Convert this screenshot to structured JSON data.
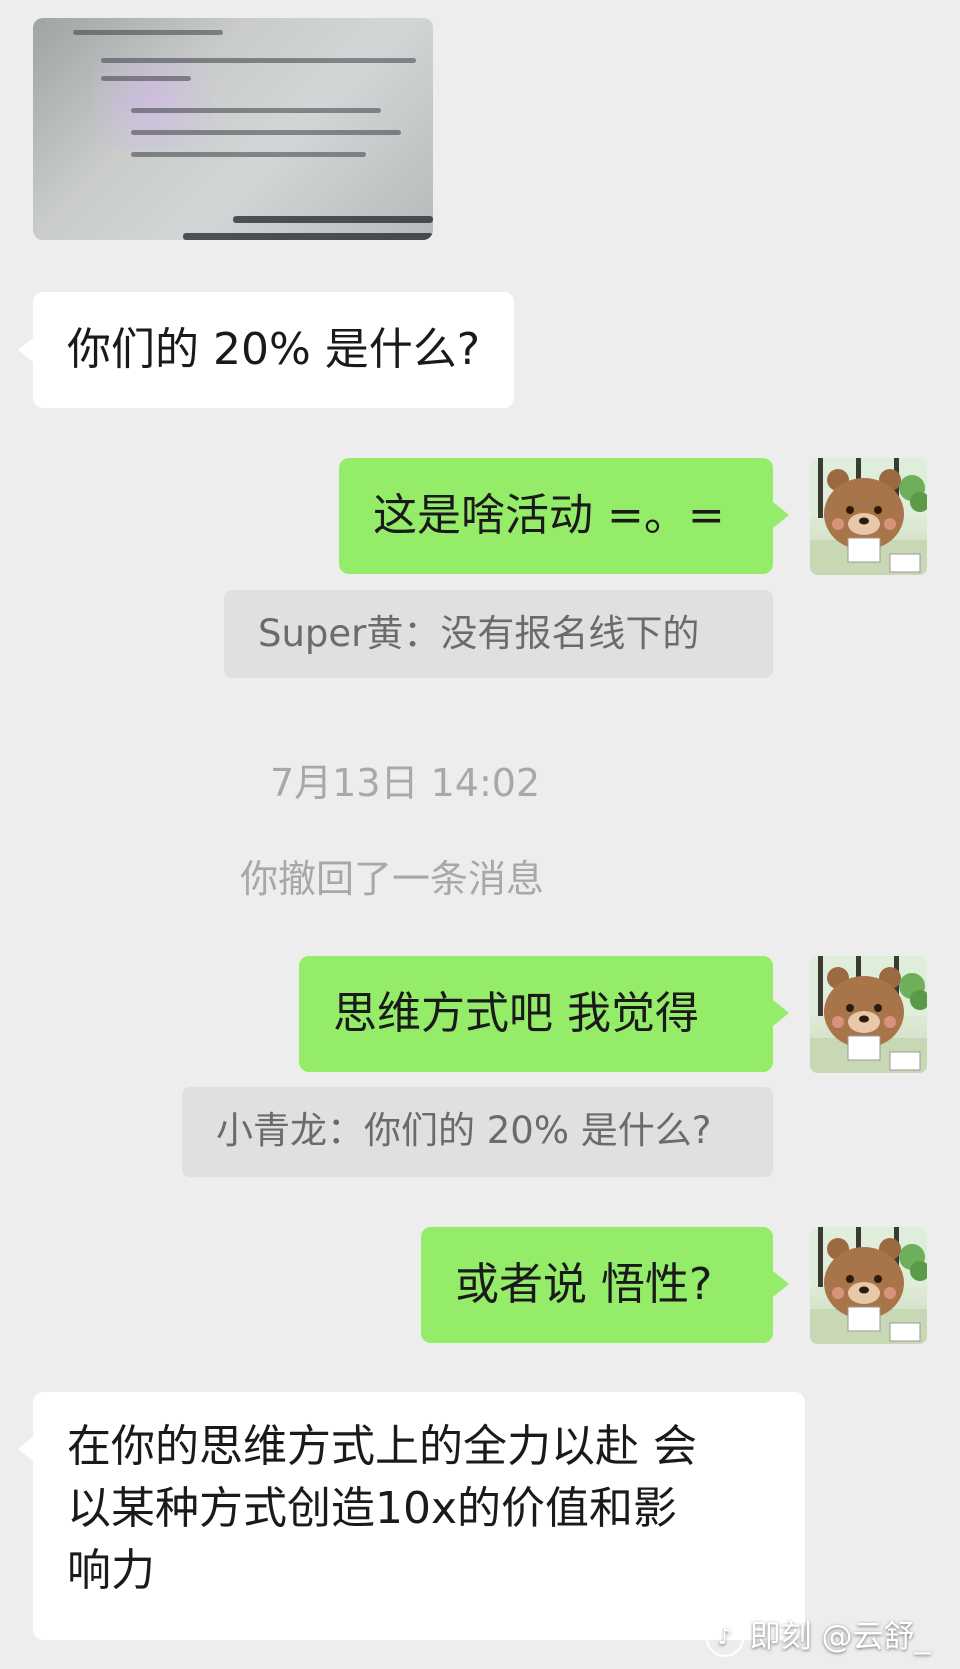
{
  "messages": {
    "m1_text": "你们的 20% 是什么?",
    "m2_text": "这是啥活动 =。=",
    "m2_quote": "Super黄：没有报名线下的",
    "timestamp": "7月13日 14:02",
    "recalled": "你撤回了一条消息",
    "m3_text": "思维方式吧 我觉得",
    "m3_quote": "小青龙：你们的 20% 是什么?",
    "m4_text": "或者说 悟性?",
    "m5_line1": "在你的思维方式上的全力以赴 会",
    "m5_line2": "以某种方式创造10x的价值和影",
    "m5_line3": "响力"
  },
  "watermark": {
    "icon": "♪",
    "text": "即刻 @云舒_"
  },
  "colors": {
    "background": "#ededed",
    "bubble_self": "#95ec69",
    "bubble_other": "#ffffff",
    "quote_bg": "#e0e0e0"
  }
}
